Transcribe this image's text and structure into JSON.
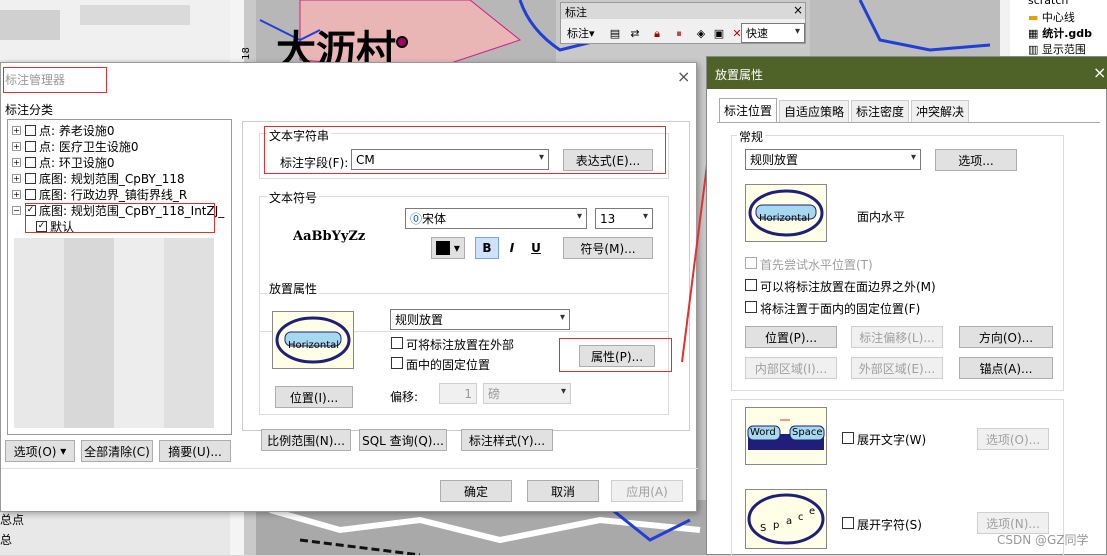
{
  "background": {
    "map_label": "大沥村",
    "ruler": "18",
    "left_pane_texts": [
      "总点",
      "总"
    ]
  },
  "toolbar": {
    "title": "标注",
    "menu_label": "标注",
    "combo_value": "快速",
    "icons": [
      "label-manager-icon",
      "label-weight-icon",
      "lock-labels-icon",
      "pause-labeling-icon",
      "view-unplaced-icon",
      "place-label-icon",
      "delete-label-icon"
    ]
  },
  "catalog": {
    "items": [
      "scratch",
      "中心线",
      "统计.gdb",
      "显示范围"
    ]
  },
  "label_manager": {
    "title": "标注管理器",
    "class_label": "标注分类",
    "tree": [
      {
        "label": "点: 养老设施0",
        "checked": false
      },
      {
        "label": "点: 医疗卫生设施0",
        "checked": false
      },
      {
        "label": "点: 环卫设施0",
        "checked": false
      },
      {
        "label": "底图: 规划范围_CpBY_118",
        "checked": false
      },
      {
        "label": "底图: 行政边界_镇街界线_R",
        "checked": false
      },
      {
        "label": "底图: 规划范围_CpBY_118_IntZJ_",
        "checked": true
      }
    ],
    "tree_child": {
      "label": "默认",
      "checked": true
    },
    "text_string": {
      "group": "文本字符串",
      "field_label": "标注字段(F):",
      "field_value": "CM",
      "expr_button": "表达式(E)..."
    },
    "text_symbol": {
      "group": "文本符号",
      "sample": "AaBbYyZz",
      "font": "宋体",
      "size": "13",
      "bold": "B",
      "italic": "I",
      "underline": "U",
      "symbol_button": "符号(M)..."
    },
    "placement": {
      "group": "放置属性",
      "preview_text": "Horizontal",
      "mode": "规则放置",
      "outside_label": "可将标注放置在外部",
      "fixed_label": "面中的固定位置",
      "props_button": "属性(P)...",
      "position_button": "位置(I)...",
      "offset_label": "偏移:",
      "offset_value": "1",
      "offset_unit": "磅"
    },
    "bottom_left": {
      "options": "选项(O)",
      "clear_all": "全部清除(C)",
      "summary": "摘要(U)..."
    },
    "bottom_mid": {
      "scale_range": "比例范围(N)...",
      "sql_query": "SQL 查询(Q)...",
      "label_style": "标注样式(Y)..."
    },
    "footer": {
      "ok": "确定",
      "cancel": "取消",
      "apply": "应用(A)"
    }
  },
  "placement_props": {
    "title": "放置属性",
    "tabs": [
      "标注位置",
      "自适应策略",
      "标注密度",
      "冲突解决"
    ],
    "general": {
      "group": "常规",
      "mode": "规则放置",
      "options_button": "选项...",
      "preview_text": "Horizontal",
      "preview_caption": "面内水平",
      "try_horizontal": "首先尝试水平位置(T)",
      "outside_boundary": "可以将标注放置在面边界之外(M)",
      "fixed_position": "将标注置于面内的固定位置(F)",
      "position_button": "位置(P)...",
      "offset_button": "标注偏移(L)...",
      "direction_button": "方向(O)...",
      "inner_button": "内部区域(I)...",
      "outer_button": "外部区域(E)...",
      "anchor_button": "锚点(A)..."
    },
    "spread_words": {
      "word1": "Word",
      "word2": "Space",
      "label": "展开文字(W)",
      "options_button": "选项(O)..."
    },
    "spread_chars": {
      "chars": [
        "S",
        "p",
        "a",
        "c",
        "e"
      ],
      "label": "展开字符(S)",
      "options_button": "选项(N)..."
    }
  },
  "watermark": "CSDN @GZ同学",
  "colors": {
    "accent_red": "#e03030",
    "panel_header": "#4f6228",
    "preview_fill": "#ffffe8",
    "ellipse": "#1f1f7a"
  }
}
